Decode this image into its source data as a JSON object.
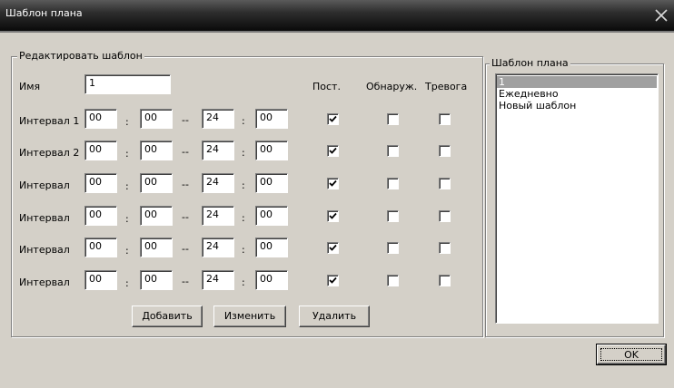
{
  "window": {
    "title": "Шаблон плана"
  },
  "editor": {
    "group_title": "Редактировать шаблон",
    "name_label": "Имя",
    "name_value": "1",
    "col_const": "Пост.",
    "col_detect": "Обнаруж.",
    "col_alarm": "Тревога",
    "separator_colon": ":",
    "separator_dash": "--",
    "rows": [
      {
        "label": "Интервал 1",
        "h1": "00",
        "m1": "00",
        "h2": "24",
        "m2": "00",
        "const": true,
        "detect": false,
        "alarm": false
      },
      {
        "label": "Интервал 2",
        "h1": "00",
        "m1": "00",
        "h2": "24",
        "m2": "00",
        "const": true,
        "detect": false,
        "alarm": false
      },
      {
        "label": "Интервал",
        "h1": "00",
        "m1": "00",
        "h2": "24",
        "m2": "00",
        "const": true,
        "detect": false,
        "alarm": false
      },
      {
        "label": "Интервал",
        "h1": "00",
        "m1": "00",
        "h2": "24",
        "m2": "00",
        "const": true,
        "detect": false,
        "alarm": false
      },
      {
        "label": "Интервал",
        "h1": "00",
        "m1": "00",
        "h2": "24",
        "m2": "00",
        "const": true,
        "detect": false,
        "alarm": false
      },
      {
        "label": "Интервал",
        "h1": "00",
        "m1": "00",
        "h2": "24",
        "m2": "00",
        "const": true,
        "detect": false,
        "alarm": false
      }
    ],
    "add_label": "Добавить",
    "edit_label": "Изменить",
    "delete_label": "Удалить"
  },
  "templates": {
    "group_title": "Шаблон плана",
    "items": [
      "1",
      "Ежедневно",
      "Новый шаблон"
    ],
    "selected_index": 0
  },
  "ok_label": "OK",
  "icons": {
    "close": "close-icon",
    "check": "check-icon"
  }
}
